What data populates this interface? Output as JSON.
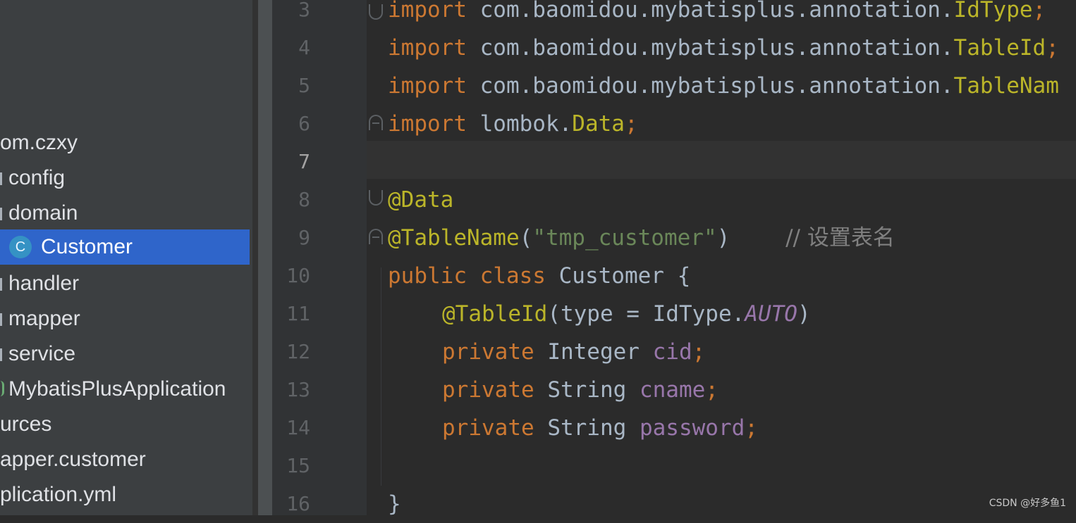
{
  "project_tree": {
    "items": [
      {
        "label": "om.czxy",
        "type": "package"
      },
      {
        "label": "config",
        "type": "folder"
      },
      {
        "label": "domain",
        "type": "folder"
      },
      {
        "label": "Customer",
        "type": "class",
        "icon_letter": "C",
        "selected": true
      },
      {
        "label": "handler",
        "type": "folder"
      },
      {
        "label": "mapper",
        "type": "folder"
      },
      {
        "label": "service",
        "type": "folder"
      },
      {
        "label": "MybatisPlusApplication",
        "type": "spring-class"
      },
      {
        "label": "urces",
        "type": "folder"
      },
      {
        "label": "apper.customer",
        "type": "folder"
      },
      {
        "label": "plication.yml",
        "type": "file"
      }
    ]
  },
  "editor": {
    "current_line": "7",
    "line_numbers": [
      "3",
      "4",
      "5",
      "6",
      "7",
      "8",
      "9",
      "10",
      "11",
      "12",
      "13",
      "14",
      "15",
      "16"
    ],
    "tokens": {
      "l3": [
        "import",
        " com.baomidou.mybatisplus.annotation.",
        "IdType",
        ";"
      ],
      "l4": [
        "import",
        " com.baomidou.mybatisplus.annotation.",
        "TableId",
        ";"
      ],
      "l5": [
        "import",
        " com.baomidou.mybatisplus.annotation.",
        "TableNam"
      ],
      "l6": [
        "import",
        " lombok.",
        "Data",
        ";"
      ],
      "l8": [
        "@Data"
      ],
      "l9": [
        "@TableName",
        "(",
        "\"tmp_customer\"",
        ")",
        "        // 设置表名"
      ],
      "l10": [
        "public",
        " ",
        "class",
        " Customer {"
      ],
      "l11": [
        "@TableId",
        "(type = IdType.",
        "AUTO",
        ")"
      ],
      "l12": [
        "private",
        " Integer ",
        "cid",
        ";"
      ],
      "l13": [
        "private",
        " String ",
        "cname",
        ";"
      ],
      "l14": [
        "private",
        " String ",
        "password",
        ";"
      ],
      "l16": [
        "}"
      ]
    }
  },
  "colors": {
    "keyword": "#cc7832",
    "annotation": "#bbb529",
    "string": "#6a8759",
    "comment": "#808080",
    "field": "#9876aa",
    "selection": "#2f65ca"
  },
  "watermark": "CSDN @好多鱼1"
}
